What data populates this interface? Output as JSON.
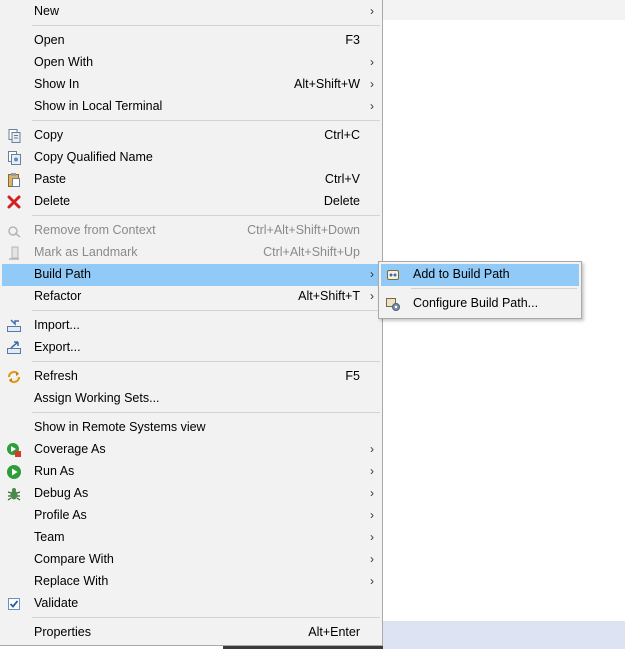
{
  "context_menu": {
    "items": [
      {
        "label": "New",
        "shortcut": "",
        "submenu": true,
        "enabled": true,
        "icon": "none"
      },
      {
        "label": "Open",
        "shortcut": "F3",
        "submenu": false,
        "enabled": true,
        "icon": "none"
      },
      {
        "label": "Open With",
        "shortcut": "",
        "submenu": true,
        "enabled": true,
        "icon": "none"
      },
      {
        "label": "Show In",
        "shortcut": "Alt+Shift+W",
        "submenu": true,
        "enabled": true,
        "icon": "none"
      },
      {
        "label": "Show in Local Terminal",
        "shortcut": "",
        "submenu": true,
        "enabled": true,
        "icon": "none"
      },
      {
        "label": "Copy",
        "shortcut": "Ctrl+C",
        "submenu": false,
        "enabled": true,
        "icon": "copy-icon"
      },
      {
        "label": "Copy Qualified Name",
        "shortcut": "",
        "submenu": false,
        "enabled": true,
        "icon": "copy-qualified-name-icon"
      },
      {
        "label": "Paste",
        "shortcut": "Ctrl+V",
        "submenu": false,
        "enabled": true,
        "icon": "paste-icon"
      },
      {
        "label": "Delete",
        "shortcut": "Delete",
        "submenu": false,
        "enabled": true,
        "icon": "delete-icon"
      },
      {
        "label": "Remove from Context",
        "shortcut": "Ctrl+Alt+Shift+Down",
        "submenu": false,
        "enabled": false,
        "icon": "remove-from-context-icon"
      },
      {
        "label": "Mark as Landmark",
        "shortcut": "Ctrl+Alt+Shift+Up",
        "submenu": false,
        "enabled": false,
        "icon": "landmark-icon"
      },
      {
        "label": "Build Path",
        "shortcut": "",
        "submenu": true,
        "enabled": true,
        "icon": "none",
        "highlighted": true
      },
      {
        "label": "Refactor",
        "shortcut": "Alt+Shift+T",
        "submenu": true,
        "enabled": true,
        "icon": "none"
      },
      {
        "label": "Import...",
        "shortcut": "",
        "submenu": false,
        "enabled": true,
        "icon": "import-icon"
      },
      {
        "label": "Export...",
        "shortcut": "",
        "submenu": false,
        "enabled": true,
        "icon": "export-icon"
      },
      {
        "label": "Refresh",
        "shortcut": "F5",
        "submenu": false,
        "enabled": true,
        "icon": "refresh-icon"
      },
      {
        "label": "Assign Working Sets...",
        "shortcut": "",
        "submenu": false,
        "enabled": true,
        "icon": "none"
      },
      {
        "label": "Show in Remote Systems view",
        "shortcut": "",
        "submenu": false,
        "enabled": true,
        "icon": "none"
      },
      {
        "label": "Coverage As",
        "shortcut": "",
        "submenu": true,
        "enabled": true,
        "icon": "coverage-icon"
      },
      {
        "label": "Run As",
        "shortcut": "",
        "submenu": true,
        "enabled": true,
        "icon": "run-icon"
      },
      {
        "label": "Debug As",
        "shortcut": "",
        "submenu": true,
        "enabled": true,
        "icon": "debug-icon"
      },
      {
        "label": "Profile As",
        "shortcut": "",
        "submenu": true,
        "enabled": true,
        "icon": "none"
      },
      {
        "label": "Team",
        "shortcut": "",
        "submenu": true,
        "enabled": true,
        "icon": "none"
      },
      {
        "label": "Compare With",
        "shortcut": "",
        "submenu": true,
        "enabled": true,
        "icon": "none"
      },
      {
        "label": "Replace With",
        "shortcut": "",
        "submenu": true,
        "enabled": true,
        "icon": "none"
      },
      {
        "label": "Validate",
        "shortcut": "",
        "submenu": false,
        "enabled": true,
        "icon": "validate-checkbox-icon"
      },
      {
        "label": "Properties",
        "shortcut": "Alt+Enter",
        "submenu": false,
        "enabled": true,
        "icon": "none"
      }
    ],
    "submenu_arrow": "›"
  },
  "build_path_submenu": {
    "items": [
      {
        "label": "Add to Build Path",
        "icon": "add-to-build-path-icon",
        "highlighted": true
      },
      {
        "label": "Configure Build Path...",
        "icon": "configure-build-path-icon",
        "highlighted": false
      }
    ]
  },
  "colors": {
    "menu_background": "#f2f2f2",
    "highlight": "#91c9f7",
    "disabled_text": "#8a8a8a",
    "separator": "#d2d2d2"
  }
}
